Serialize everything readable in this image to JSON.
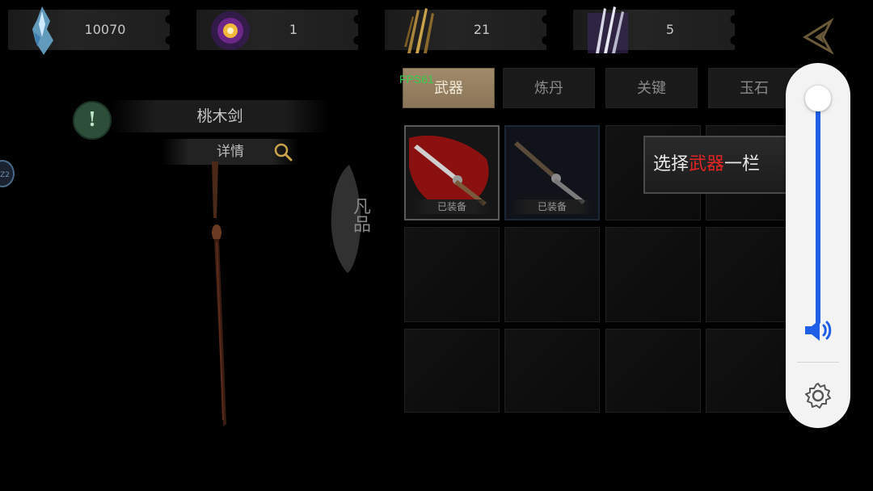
{
  "resources": [
    {
      "name": "crystal",
      "value": "10070",
      "icon": "blue-crystal-icon"
    },
    {
      "name": "orb",
      "value": "1",
      "icon": "glowing-orb-icon"
    },
    {
      "name": "gold-arrows",
      "value": "21",
      "icon": "gold-arrows-icon"
    },
    {
      "name": "purple-arrows",
      "value": "5",
      "icon": "purple-arrows-icon"
    }
  ],
  "item": {
    "name": "桃木剑",
    "detail_label": "详情",
    "rank": "凡品",
    "side_badge": "Z2"
  },
  "fps": "FPS61",
  "tabs": [
    "武器",
    "炼丹",
    "关键",
    "玉石"
  ],
  "active_tab": 0,
  "slots": [
    {
      "label": "已装备"
    },
    {
      "label": "已装备"
    }
  ],
  "tip": {
    "prefix": "选择",
    "highlight": "武器",
    "suffix": "一栏"
  },
  "volume": {
    "level": 0.95,
    "colors": {
      "accent": "#1f5fe8"
    }
  }
}
